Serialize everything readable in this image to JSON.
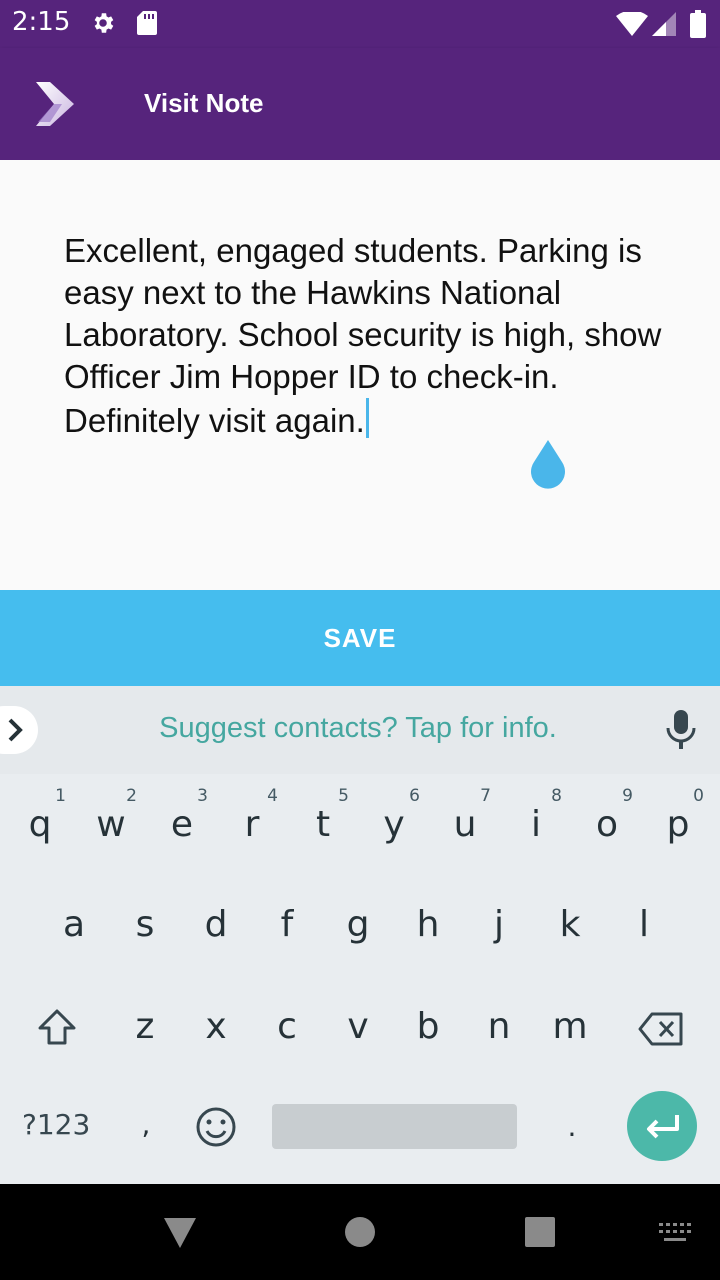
{
  "status_bar": {
    "time": "2:15",
    "icons": [
      "settings-icon",
      "sd-card-icon",
      "wifi-icon",
      "signal-icon",
      "battery-icon"
    ]
  },
  "app_bar": {
    "title": "Visit Note",
    "background": "#56247c"
  },
  "note": {
    "text": "Excellent, engaged students. Parking is easy next to the Hawkins National Laboratory. School security is high, show Officer Jim Hopper ID to check-in. Definitely visit again."
  },
  "save_button": {
    "label": "SAVE",
    "color": "#45bdee"
  },
  "keyboard": {
    "suggestion": "Suggest contacts? Tap for info.",
    "row1": [
      {
        "k": "q",
        "n": "1"
      },
      {
        "k": "w",
        "n": "2"
      },
      {
        "k": "e",
        "n": "3"
      },
      {
        "k": "r",
        "n": "4"
      },
      {
        "k": "t",
        "n": "5"
      },
      {
        "k": "y",
        "n": "6"
      },
      {
        "k": "u",
        "n": "7"
      },
      {
        "k": "i",
        "n": "8"
      },
      {
        "k": "o",
        "n": "9"
      },
      {
        "k": "p",
        "n": "0"
      }
    ],
    "row2": [
      "a",
      "s",
      "d",
      "f",
      "g",
      "h",
      "j",
      "k",
      "l"
    ],
    "row3": [
      "z",
      "x",
      "c",
      "v",
      "b",
      "n",
      "m"
    ],
    "symbols_label": "?123",
    "comma": ",",
    "period": ".",
    "enter_color": "#4cb8a9"
  }
}
